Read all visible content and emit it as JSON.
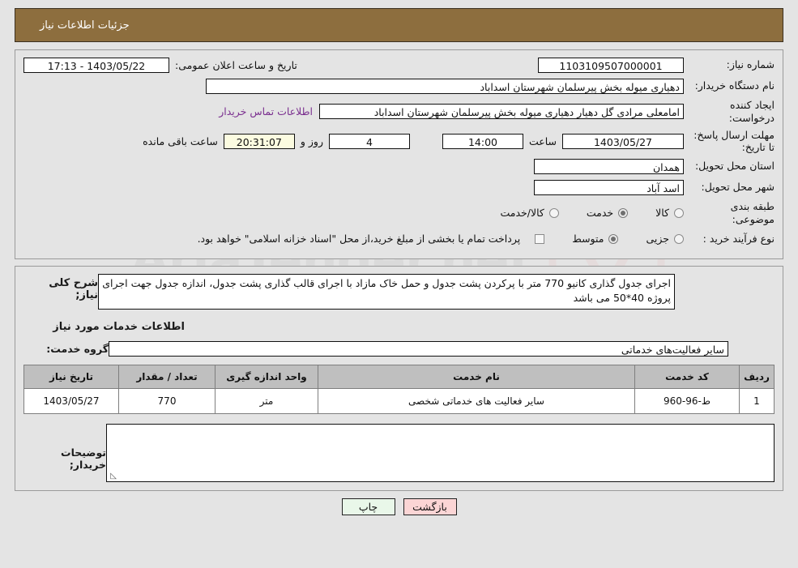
{
  "header": {
    "title": "جزئیات اطلاعات نیاز"
  },
  "form": {
    "need_number_label": "شماره نیاز:",
    "need_number_value": "1103109507000001",
    "announce_label": "تاریخ و ساعت اعلان عمومی:",
    "announce_value": "1403/05/22 - 17:13",
    "buyer_org_label": "نام دستگاه خریدار:",
    "buyer_org_value": "دهیاری میوله بخش پیرسلمان شهرستان اسداباد",
    "creator_label": "ایجاد کننده درخواست:",
    "creator_value": "امامعلی مرادی گل دهیار دهیاری میوله بخش پیرسلمان شهرستان اسداباد",
    "contact_link": "اطلاعات تماس خریدار",
    "deadline_label": "مهلت ارسال پاسخ: تا تاریخ:",
    "deadline_date": "1403/05/27",
    "hour_label": "ساعت",
    "deadline_time": "14:00",
    "days_value": "4",
    "days_label": "روز و",
    "remaining_clock": "20:31:07",
    "remaining_label": "ساعت باقی مانده",
    "province_label": "استان محل تحویل:",
    "province_value": "همدان",
    "city_label": "شهر محل تحویل:",
    "city_value": "اسد آباد",
    "category_label": "طبقه بندی موضوعی:",
    "category_options": [
      {
        "label": "کالا",
        "selected": false
      },
      {
        "label": "خدمت",
        "selected": true
      },
      {
        "label": "کالا/خدمت",
        "selected": false
      }
    ],
    "process_label": "نوع فرآیند خرید :",
    "process_options": [
      {
        "label": "جزیی",
        "selected": false
      },
      {
        "label": "متوسط",
        "selected": true
      }
    ],
    "treasury_note": "پرداخت تمام یا بخشی از مبلغ خرید،از محل \"اسناد خزانه اسلامی\" خواهد بود."
  },
  "details": {
    "description_label": "شرح کلی نیاز;",
    "description_value": "اجرای جدول گذاری کانیو 770 متر با پرکردن پشت جدول و حمل خاک مازاد با اجرای قالب گذاری پشت جدول، اندازه جدول جهت اجرای پروژه 40*50 می باشد",
    "services_heading": "اطلاعات خدمات مورد نیاز",
    "service_group_label": "گروه خدمت:",
    "service_group_value": "سایر فعالیت‌های خدماتی"
  },
  "table": {
    "columns": [
      "ردیف",
      "کد خدمت",
      "نام خدمت",
      "واحد اندازه گیری",
      "تعداد / مقدار",
      "تاریخ نیاز"
    ],
    "rows": [
      {
        "radif": "1",
        "code": "ط-96-960",
        "name": "سایر فعالیت های خدماتی شخصی",
        "unit": "متر",
        "qty": "770",
        "date": "1403/05/27"
      }
    ]
  },
  "notes": {
    "label": "توضیحات خریدار;",
    "value": ""
  },
  "footer": {
    "print_label": "چاپ",
    "back_label": "بازگشت"
  },
  "watermark": {
    "text": "AriaTender.net"
  },
  "colors": {
    "header_bar": "#8d6e3e",
    "page_bg": "#e4e4e4",
    "link": "#7a2f8f",
    "print_btn": "#e9f7e9",
    "back_btn": "#fbd5d5",
    "table_header": "#bfbfbf",
    "cream_field": "#fbfbe0"
  }
}
